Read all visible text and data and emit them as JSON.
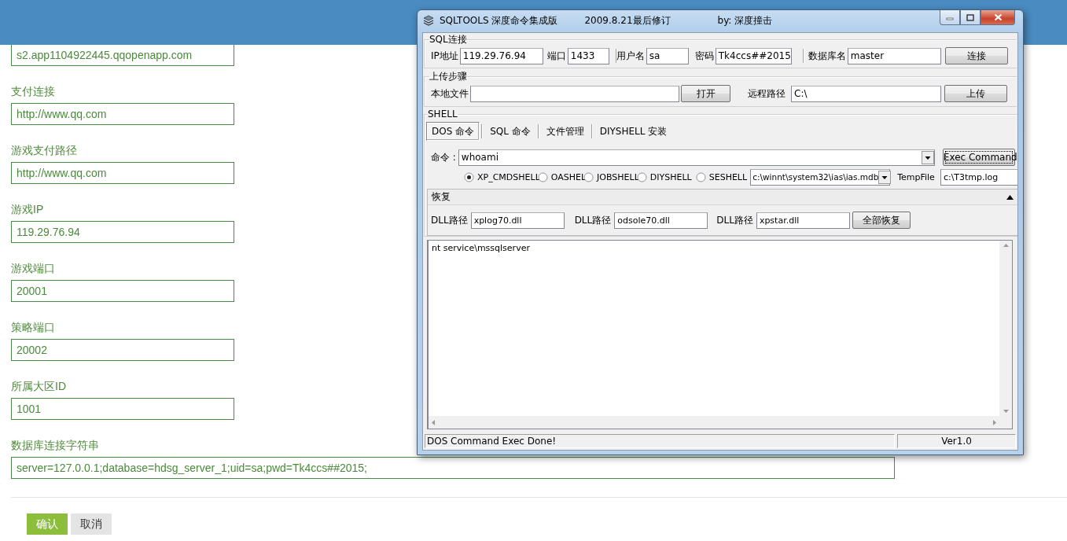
{
  "form": {
    "fields": [
      {
        "value": "s2.app1104922445.qqopenapp.com"
      },
      {
        "label": "支付连接",
        "value": "http://www.qq.com"
      },
      {
        "label": "游戏支付路径",
        "value": "http://www.qq.com"
      },
      {
        "label": "游戏IP",
        "value": "119.29.76.94"
      },
      {
        "label": "游戏端口",
        "value": "20001"
      },
      {
        "label": "策略端口",
        "value": "20002"
      },
      {
        "label": "所属大区ID",
        "value": "1001"
      },
      {
        "label": "数据库连接字符串",
        "value": "server=127.0.0.1;database=hdsg_server_1;uid=sa;pwd=Tk4ccs##2015;",
        "kind": "wide"
      }
    ],
    "buttons": [
      {
        "label": "确认",
        "kind": "primary"
      },
      {
        "label": "取消",
        "kind": "secondary"
      }
    ]
  },
  "window": {
    "title": "SQLTOOLS 深度命令集成版",
    "revision": "2009.8.21最后修订",
    "author": "by: 深度撞击",
    "sql_connection": {
      "legend": "SQL连接",
      "fields": [
        {
          "label": "IP地址",
          "value": "119.29.76.94"
        },
        {
          "label": "端口",
          "value": "1433"
        },
        {
          "label": "用户名",
          "value": "sa"
        },
        {
          "label": "密码",
          "value": "Tk4ccs##2015"
        },
        {
          "label": "数据库名",
          "value": "master"
        }
      ],
      "connect_button": "连接"
    },
    "upload": {
      "legend": "上传步骤",
      "local_label": "本地文件",
      "open_button": "打开",
      "remote_label": "远程路径",
      "remote_value": "C:\\",
      "upload_button": "上传"
    },
    "shell": {
      "legend": "SHELL",
      "tabs": [
        {
          "label": "DOS 命令",
          "selected": true
        },
        {
          "label": "SQL 命令",
          "selected": false
        },
        {
          "label": "文件管理",
          "selected": false
        },
        {
          "label": "DIYSHELL 安装",
          "selected": false
        }
      ],
      "command_label": "命令 :",
      "command": "whoami",
      "exec_button": "Exec Command",
      "shell_types": [
        {
          "label": "XP_CMDSHELL",
          "selected": true
        },
        {
          "label": "OASHEL",
          "selected": false
        },
        {
          "label": "JOBSHELL",
          "selected": false
        },
        {
          "label": "DIYSHELL",
          "selected": false
        },
        {
          "label": "SESHELL",
          "selected": false
        }
      ],
      "db_path": "c:\\winnt\\system32\\ias\\ias.mdb",
      "tempfile_label": "TempFile",
      "tempfile": "c:\\T3tmp.log"
    },
    "restore": {
      "title": "恢复",
      "dll_fields": [
        {
          "label": "DLL路径",
          "value": "xplog70.dll"
        },
        {
          "label": "DLL路径",
          "value": "odsole70.dll"
        },
        {
          "label": "DLL路径",
          "value": "xpstar.dll"
        }
      ],
      "restore_button": "全部恢复"
    },
    "output": "nt service\\mssqlserver",
    "status_bar": {
      "message": "DOS Command Exec Done!",
      "version": "Ver1.0"
    }
  }
}
